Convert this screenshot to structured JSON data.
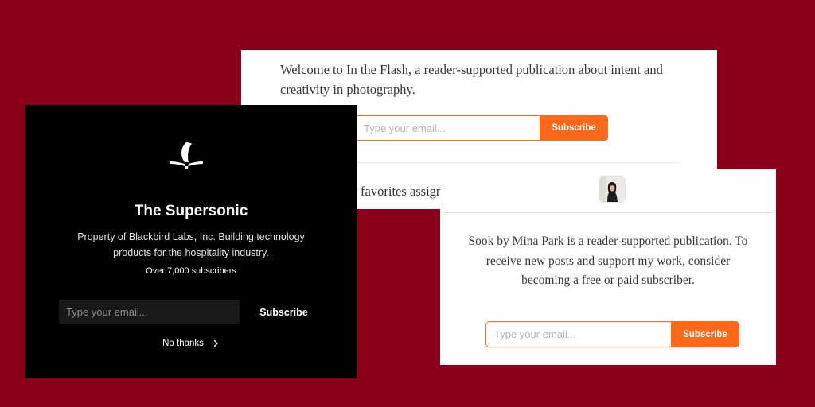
{
  "background_color": "#8a0019",
  "accent_color": "#ff6719",
  "flash_card": {
    "description": "Welcome to In the Flash, a reader-supported publication about intent and creativity in photography.",
    "email_placeholder": "Type your email...",
    "subscribe_label": "Subscribe",
    "post_title": "My favorites assignme"
  },
  "sook_card": {
    "avatar_icon": "author-avatar",
    "description": "Sook by Mina Park is a reader-supported publication. To receive new posts and support my work, consider becoming a free or paid subscriber.",
    "email_placeholder": "Type your email...",
    "subscribe_label": "Subscribe"
  },
  "supersonic_card": {
    "logo_icon": "supersonic-logo",
    "title": "The Supersonic",
    "description": "Property of Blackbird Labs, Inc. Building technology products for the hospitality industry.",
    "subscriber_count": "Over 7,000 subscribers",
    "email_placeholder": "Type your email...",
    "subscribe_label": "Subscribe",
    "no_thanks_label": "No thanks",
    "no_thanks_icon": "chevron-right-icon"
  }
}
